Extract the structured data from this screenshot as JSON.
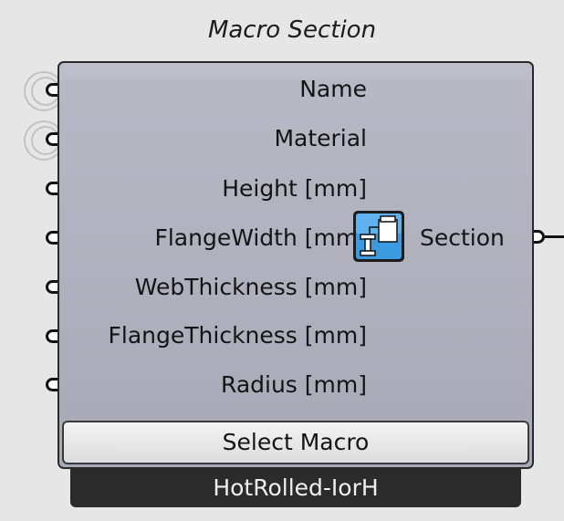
{
  "component": {
    "title": "Macro Section",
    "inputs": [
      {
        "label": "Name",
        "optional": true
      },
      {
        "label": "Material",
        "optional": true
      },
      {
        "label": "Height [mm]",
        "optional": false
      },
      {
        "label": "FlangeWidth [mm]",
        "optional": false
      },
      {
        "label": "WebThickness [mm]",
        "optional": false
      },
      {
        "label": "FlangeThickness [mm]",
        "optional": false
      },
      {
        "label": "Radius [mm]",
        "optional": false
      }
    ],
    "output": {
      "label": "Section",
      "icon": "i-beam-section-icon"
    },
    "select_button_label": "Select Macro",
    "macro_name": "HotRolled-IorH",
    "colors": {
      "body": "#b2b2c0",
      "tag": "#2b2b2b",
      "icon_accent": "#3b9ae0"
    }
  }
}
